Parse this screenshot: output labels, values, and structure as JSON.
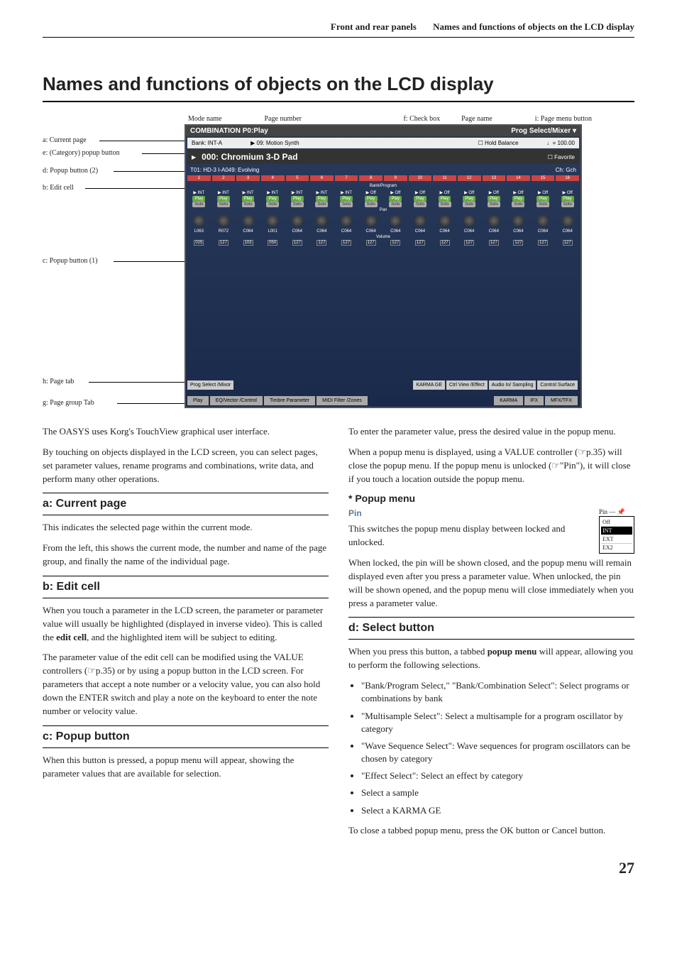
{
  "header": {
    "left": "Front and rear panels",
    "right": "Names and functions of objects on the LCD display"
  },
  "title": "Names and functions of objects on the LCD display",
  "diagram": {
    "topLabels": [
      "Mode name",
      "Page number",
      "f: Check box",
      "Page name",
      "i: Page menu button"
    ],
    "leftLabels": {
      "a": "a: Current page",
      "e": "e: (Category) popup button",
      "d": "d: Popup button (2)",
      "b": "b: Edit cell",
      "c": "c: Popup button (1)",
      "h": "h: Page tab",
      "g": "g: Page group Tab"
    },
    "screen": {
      "titleLeft": "COMBINATION P0:Play",
      "titleRight": "Prog Select/Mixer",
      "bankLabel": "Bank: INT-A",
      "category": "09: Motion Synth",
      "holdBalance": "Hold Balance",
      "tempo": "100.00",
      "progName": "000: Chromium 3-D Pad",
      "favorite": "Favorite",
      "t01": "T01: HD-3 I-A049: Evolving",
      "chLabel": "Ch: Gch",
      "trackHeads": [
        "1",
        "2",
        "3",
        "4",
        "5",
        "6",
        "7",
        "8",
        "9",
        "10",
        "11",
        "12",
        "13",
        "14",
        "15",
        "16"
      ],
      "playLabel": "Play",
      "soloLabel": "Solo",
      "int": "INT",
      "off": "Off",
      "panValues": [
        "L063",
        "R072",
        "C064",
        "L001",
        "C064",
        "C064",
        "C064",
        "C064",
        "C064",
        "C064",
        "C064",
        "C064",
        "C064",
        "C064",
        "C064",
        "C064"
      ],
      "volValues": [
        "025",
        "127",
        "103",
        "050",
        "127",
        "127",
        "127",
        "127",
        "127",
        "127",
        "127",
        "127",
        "127",
        "127",
        "127",
        "127"
      ],
      "bottomTabs": [
        "Prog Select /Mixor",
        "KARMA GE",
        "Ctrl View /Effect",
        "Audio In/ Sampling",
        "Control Surface"
      ],
      "groupTabs": [
        "Play",
        "EQ/Vector /Control",
        "Timbre Parameter",
        "MIDI Filter /Zones",
        "KARMA",
        "IFX",
        "MFX/TFX"
      ]
    }
  },
  "body": {
    "intro1": "The OASYS uses Korg's TouchView graphical user interface.",
    "intro2": "By touching on objects displayed in the LCD screen, you can select pages, set parameter values, rename programs and combinations, write data, and perform many other operations.",
    "a_title": "a: Current page",
    "a_p1": "This indicates the selected page within the current mode.",
    "a_p2": "From the left, this shows the current mode, the number and name of the page group, and finally the name of the individual page.",
    "b_title": "b: Edit cell",
    "b_p1": "When you touch a parameter in the LCD screen, the parameter or parameter value will usually be highlighted (displayed in inverse video). This is called the edit cell, and the highlighted item will be subject to editing.",
    "b_p2": "The parameter value of the edit cell can be modified using the VALUE controllers (☞p.35) or by using a popup button in the LCD screen. For parameters that accept a note number or a velocity value, you can also hold down the ENTER switch and play a note on the keyboard to enter the note number or velocity value.",
    "c_title": "c: Popup button",
    "c_p1": "When this button is pressed, a popup menu will appear, showing the parameter values that are available for selection.",
    "c_p2": "To enter the parameter value, press the desired value in the popup menu.",
    "c_p3": "When a popup menu is displayed, using a VALUE controller (☞p.35) will close the popup menu. If the popup menu is unlocked (☞\"Pin\"), it will close if you touch a location outside the popup menu.",
    "popup_title": "* Popup menu",
    "pin_title": "Pin",
    "pin_label": "Pin",
    "pin_p1": "This switches the popup menu display between locked and unlocked.",
    "pin_p2": "When locked, the pin will be shown closed, and the popup menu will remain displayed even after you press a parameter value. When unlocked, the pin will be shown opened, and the popup menu will close immediately when you press a parameter value.",
    "pin_options": [
      "Off",
      "INT",
      "EXT",
      "EX2"
    ],
    "d_title": "d: Select button",
    "d_p1": "When you press this button, a tabbed popup menu will appear, allowing you to perform the following selections.",
    "d_list": [
      "\"Bank/Program Select,\" \"Bank/Combination Select\": Select programs or combinations by bank",
      "\"Multisample Select\": Select a multisample for a program oscillator by category",
      "\"Wave Sequence Select\": Wave sequences for program oscillators can be chosen by category",
      "\"Effect Select\": Select an effect by category",
      "Select a sample",
      "Select a KARMA GE"
    ],
    "d_p2": "To close a tabbed popup menu, press the OK button or Cancel button."
  },
  "pageNumber": "27"
}
